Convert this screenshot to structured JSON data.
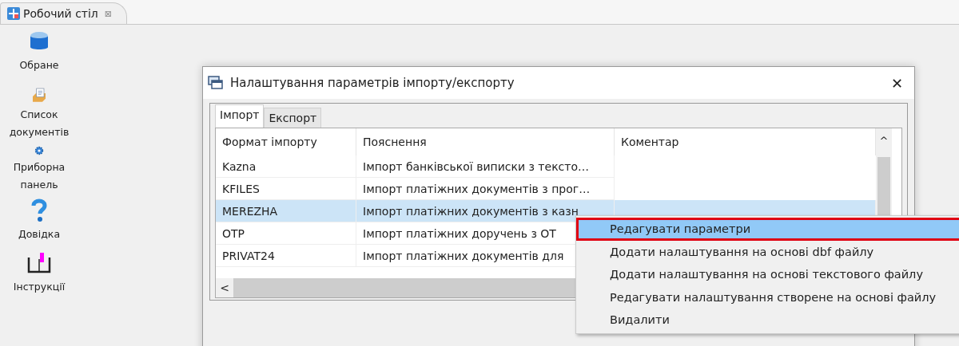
{
  "editor_tab": {
    "title": "Робочий стіл",
    "close": "⊠"
  },
  "sidebar": {
    "items": [
      {
        "kind": "favorites",
        "label": "Обране"
      },
      {
        "kind": "documents",
        "label": "Список документів"
      },
      {
        "kind": "dashboard",
        "label": "Приборна панель"
      },
      {
        "kind": "help",
        "label": "Довідка"
      },
      {
        "kind": "manual",
        "label": "Інструкції"
      }
    ]
  },
  "dialog": {
    "title": "Налаштування параметрів імпорту/експорту",
    "close": "✕",
    "tabs": [
      {
        "label": "Імпорт",
        "selected": true
      },
      {
        "label": "Експорт",
        "selected": false
      }
    ],
    "table": {
      "columns": [
        "Формат імпорту",
        "Пояснення",
        "Коментар"
      ],
      "rows": [
        {
          "cells": [
            "Kazna",
            "Імпорт банківської виписки з тексто…",
            ""
          ],
          "selected": false
        },
        {
          "cells": [
            "KFILES",
            "Імпорт платіжних документів з прог…",
            ""
          ],
          "selected": false
        },
        {
          "cells": [
            "MEREZHA",
            "Імпорт платіжних документів з казн",
            ""
          ],
          "selected": true
        },
        {
          "cells": [
            "OTP",
            "Імпорт платіжних доручень з ОТ",
            ""
          ],
          "selected": false
        },
        {
          "cells": [
            "PRIVAT24",
            "Імпорт платіжних документів для",
            ""
          ],
          "selected": false
        }
      ],
      "scroll_left": "<",
      "scroll_up": "^"
    }
  },
  "context_menu": {
    "items": [
      {
        "label": "Редагувати параметри",
        "selected": true
      },
      {
        "label": "Додати налаштування на основі dbf файлу",
        "selected": false
      },
      {
        "label": "Додати налаштування на основі текстового файлу",
        "selected": false
      },
      {
        "label": "Редагувати налаштування створене на основі файлу",
        "selected": false
      },
      {
        "label": "Видалити",
        "selected": false
      }
    ]
  }
}
